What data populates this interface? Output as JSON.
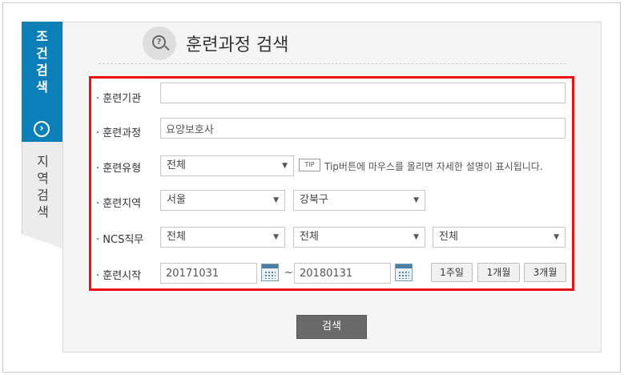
{
  "side_tabs": {
    "active": {
      "label_lines": [
        "조",
        "건",
        "검",
        "색"
      ],
      "arrow": "›"
    },
    "inactive": {
      "label_lines": [
        "지",
        "역",
        "검",
        "색"
      ]
    }
  },
  "header": {
    "title": "훈련과정 검색",
    "icon": "question-search-icon"
  },
  "form": {
    "institution": {
      "label": "· 훈련기관",
      "value": ""
    },
    "course": {
      "label": "· 훈련과정",
      "value": "요양보호사"
    },
    "type": {
      "label": "· 훈련유형",
      "selected": "전체",
      "tip_badge": "TIP",
      "tip_text": "Tip버튼에 마우스를 올리면 자세한 설명이 표시됩니다."
    },
    "region": {
      "label": "· 훈련지역",
      "city": "서울",
      "district": "강북구"
    },
    "ncs": {
      "label": "· NCS직무",
      "level1": "전체",
      "level2": "전체",
      "level3": "전체"
    },
    "start": {
      "label": "· 훈련시작",
      "from": "20171031",
      "separator": "~",
      "to": "20180131",
      "quick": [
        "1주일",
        "1개월",
        "3개월"
      ]
    }
  },
  "search_button": "검색",
  "colors": {
    "accent": "#0b7fb8",
    "highlight_border": "#e81010",
    "button": "#6a6a6a"
  }
}
